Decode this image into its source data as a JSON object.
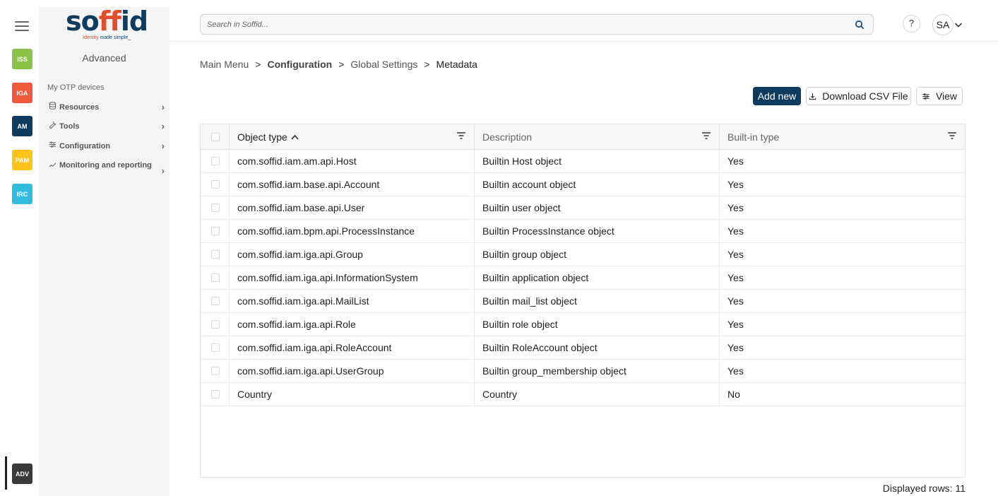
{
  "rail": {
    "apps": [
      {
        "label": "ISS",
        "color": "#8bc34a"
      },
      {
        "label": "IGA",
        "color": "#f05a3a"
      },
      {
        "label": "AM",
        "color": "#0f3c5e"
      },
      {
        "label": "PAM",
        "color": "#fcc419"
      },
      {
        "label": "IRC",
        "color": "#33bbe0"
      }
    ],
    "active_app": {
      "label": "ADV",
      "color": "#3a3a3a"
    }
  },
  "logo": {
    "word_a": "so",
    "word_b": "ff",
    "word_c": "id",
    "tag_a": "Identity",
    "tag_b": "made simple_"
  },
  "sidebar": {
    "title": "Advanced",
    "link": "My OTP devices",
    "items": [
      {
        "label": "Resources",
        "icon": "database-icon"
      },
      {
        "label": "Tools",
        "icon": "wrench-icon"
      },
      {
        "label": "Configuration",
        "icon": "sliders-icon"
      },
      {
        "label": "Monitoring and reporting",
        "icon": "chart-line-icon"
      }
    ]
  },
  "search": {
    "placeholder": "Search in Soffid..."
  },
  "header": {
    "help": "?",
    "avatar": "SA"
  },
  "breadcrumb": {
    "items": [
      "Main Menu",
      "Configuration",
      "Global Settings",
      "Metadata"
    ],
    "separator": ">"
  },
  "actions": {
    "add": "Add new",
    "csv": "Download CSV File",
    "view": "View"
  },
  "table": {
    "columns": [
      "Object type",
      "Description",
      "Built-in type"
    ],
    "rows": [
      [
        "com.soffid.iam.am.api.Host",
        "Builtin Host object",
        "Yes"
      ],
      [
        "com.soffid.iam.base.api.Account",
        "Builtin account object",
        "Yes"
      ],
      [
        "com.soffid.iam.base.api.User",
        "Builtin user object",
        "Yes"
      ],
      [
        "com.soffid.iam.bpm.api.ProcessInstance",
        "Builtin ProcessInstance object",
        "Yes"
      ],
      [
        "com.soffid.iam.iga.api.Group",
        "Builtin group object",
        "Yes"
      ],
      [
        "com.soffid.iam.iga.api.InformationSystem",
        "Builtin application object",
        "Yes"
      ],
      [
        "com.soffid.iam.iga.api.MailList",
        "Builtin mail_list object",
        "Yes"
      ],
      [
        "com.soffid.iam.iga.api.Role",
        "Builtin role object",
        "Yes"
      ],
      [
        "com.soffid.iam.iga.api.RoleAccount",
        "Builtin RoleAccount object",
        "Yes"
      ],
      [
        "com.soffid.iam.iga.api.UserGroup",
        "Builtin group_membership object",
        "Yes"
      ],
      [
        "Country",
        "Country",
        "No"
      ]
    ]
  },
  "footer": {
    "displayed_rows": "Displayed rows: 11"
  }
}
